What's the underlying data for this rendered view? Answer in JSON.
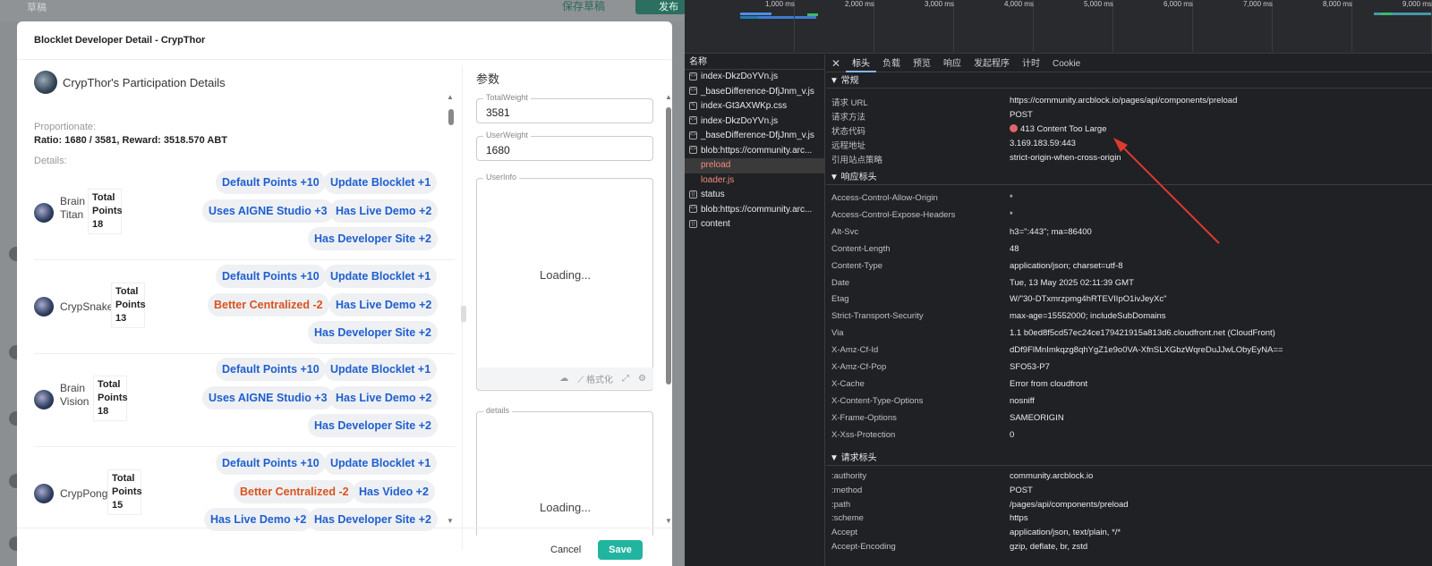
{
  "background_app": {
    "crumb": "草稿",
    "draft_label": "保存草稿",
    "publish_label": "发布"
  },
  "modal": {
    "title": "Blocklet Developer Detail - CrypThor",
    "participation_title": "CrypThor's Participation Details",
    "proportionate_label": "Proportionate:",
    "ratio_text": "Ratio: 1680 / 3581, Reward: 3518.570 ABT",
    "details_label": "Details:",
    "users": [
      {
        "name_line1": "Brain",
        "name_line2": "Titan",
        "points_label": "Total Points",
        "points": "18",
        "chips": [
          "Default Points +10",
          "Update Blocklet +1",
          "Uses AIGNE Studio +3",
          "Has Live Demo +2",
          "Has Developer Site +2"
        ]
      },
      {
        "name_line1": "CrypSnake",
        "name_line2": "",
        "points_label": "Total Points",
        "points": "13",
        "chips": [
          "Default Points +10",
          "Update Blocklet +1",
          "Better Centralized -2",
          "Has Live Demo +2",
          "Has Developer Site +2"
        ]
      },
      {
        "name_line1": "Brain",
        "name_line2": "Vision",
        "points_label": "Total Points",
        "points": "18",
        "chips": [
          "Default Points +10",
          "Update Blocklet +1",
          "Uses AIGNE Studio +3",
          "Has Live Demo +2",
          "Has Developer Site +2"
        ]
      },
      {
        "name_line1": "CrypPong",
        "name_line2": "",
        "points_label": "Total Points",
        "points": "15",
        "chips": [
          "Default Points +10",
          "Update Blocklet +1",
          "Better Centralized -2",
          "Has Video +2",
          "Has Live Demo +2",
          "Has Developer Site +2"
        ]
      }
    ],
    "params": {
      "title": "参数",
      "total_weight_label": "TotalWeight",
      "total_weight": "3581",
      "user_weight_label": "UserWeight",
      "user_weight": "1680",
      "user_info_label": "UserInfo",
      "user_info_loading": "Loading...",
      "format_label": "格式化",
      "details_label": "details",
      "details_loading": "Loading..."
    },
    "cancel_label": "Cancel",
    "save_label": "Save"
  },
  "devtools": {
    "timeline_ticks": [
      "1,000 ms",
      "2,000 ms",
      "3,000 ms",
      "4,000 ms",
      "5,000 ms",
      "6,000 ms",
      "7,000 ms",
      "8,000 ms",
      "9,000 ms"
    ],
    "name_header": "名称",
    "requests": [
      {
        "name": "index-DkzDoYVn.js",
        "type": "script",
        "error": false
      },
      {
        "name": "_baseDifference-DfjJnm_v.js",
        "type": "script",
        "error": false
      },
      {
        "name": "index-Gt3AXWKp.css",
        "type": "css",
        "error": false
      },
      {
        "name": "index-DkzDoYVn.js",
        "type": "script",
        "error": false
      },
      {
        "name": "_baseDifference-DfjJnm_v.js",
        "type": "script",
        "error": false
      },
      {
        "name": "blob:https://community.arc...",
        "type": "script",
        "error": false
      },
      {
        "name": "preload",
        "type": "none",
        "error": true,
        "selected": true
      },
      {
        "name": "loader.js",
        "type": "none",
        "error": true
      },
      {
        "name": "status",
        "type": "fetch",
        "error": false
      },
      {
        "name": "blob:https://community.arc...",
        "type": "script",
        "error": false
      },
      {
        "name": "content",
        "type": "fetch",
        "error": false
      }
    ],
    "tabs": [
      "标头",
      "负载",
      "预览",
      "响应",
      "发起程序",
      "计时",
      "Cookie"
    ],
    "general_title": "▼ 常规",
    "general": [
      {
        "k": "请求 URL",
        "v": "https://community.arcblock.io/pages/api/components/preload"
      },
      {
        "k": "请求方法",
        "v": "POST"
      },
      {
        "k": "状态代码",
        "v": "413 Content Too Large"
      },
      {
        "k": "远程地址",
        "v": "3.169.183.59:443"
      },
      {
        "k": "引用站点策略",
        "v": "strict-origin-when-cross-origin"
      }
    ],
    "response_title": "▼ 响应标头",
    "response_headers": [
      {
        "k": "Access-Control-Allow-Origin",
        "v": "*"
      },
      {
        "k": "Access-Control-Expose-Headers",
        "v": "*"
      },
      {
        "k": "Alt-Svc",
        "v": "h3=\":443\"; ma=86400"
      },
      {
        "k": "Content-Length",
        "v": "48"
      },
      {
        "k": "Content-Type",
        "v": "application/json; charset=utf-8"
      },
      {
        "k": "Date",
        "v": "Tue, 13 May 2025 02:11:39 GMT"
      },
      {
        "k": "Etag",
        "v": "W/\"30-DTxmrzpmg4hRTEVIIpO1ivJeyXc\""
      },
      {
        "k": "Strict-Transport-Security",
        "v": "max-age=15552000; includeSubDomains"
      },
      {
        "k": "Via",
        "v": "1.1 b0ed8f5cd57ec24ce179421915a813d6.cloudfront.net (CloudFront)"
      },
      {
        "k": "X-Amz-Cf-Id",
        "v": "dDf9FlMnImkqzg8qhYgZ1e9o0VA-XfnSLXGbzWqreDuJJwLObyEyNA=="
      },
      {
        "k": "X-Amz-Cf-Pop",
        "v": "SFO53-P7"
      },
      {
        "k": "X-Cache",
        "v": "Error from cloudfront"
      },
      {
        "k": "X-Content-Type-Options",
        "v": "nosniff"
      },
      {
        "k": "X-Frame-Options",
        "v": "SAMEORIGIN"
      },
      {
        "k": "X-Xss-Protection",
        "v": "0"
      }
    ],
    "request_title": "▼ 请求标头",
    "request_headers": [
      {
        "k": ":authority",
        "v": "community.arcblock.io"
      },
      {
        "k": ":method",
        "v": "POST"
      },
      {
        "k": ":path",
        "v": "/pages/api/components/preload"
      },
      {
        "k": ":scheme",
        "v": "https"
      },
      {
        "k": "Accept",
        "v": "application/json, text/plain, */*"
      },
      {
        "k": "Accept-Encoding",
        "v": "gzip, deflate, br, zstd"
      }
    ]
  }
}
